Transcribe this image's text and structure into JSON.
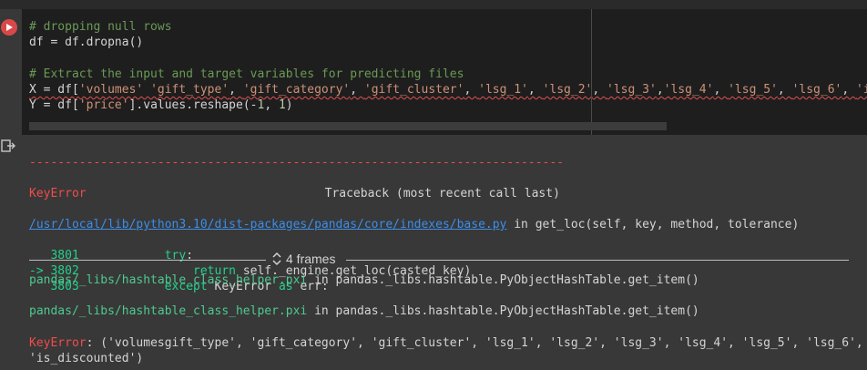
{
  "code_lines": [
    {
      "parts": [
        {
          "c": "cmt",
          "t": "# dropping null rows"
        }
      ]
    },
    {
      "parts": [
        {
          "c": "txt",
          "t": "df = df.dropna()"
        }
      ]
    },
    {
      "parts": [
        {
          "c": "txt",
          "t": ""
        }
      ]
    },
    {
      "parts": [
        {
          "c": "cmt",
          "t": "# Extract the input and target variables for predicting files"
        }
      ]
    },
    {
      "parts": [
        {
          "c": "txt squig",
          "t": "X = df["
        },
        {
          "c": "str squig",
          "t": "'volumes' 'gift_type'"
        },
        {
          "c": "txt squig",
          "t": ", "
        },
        {
          "c": "str squig",
          "t": "'gift_category'"
        },
        {
          "c": "txt squig",
          "t": ", "
        },
        {
          "c": "str squig",
          "t": "'gift_cluster'"
        },
        {
          "c": "txt squig",
          "t": ", "
        },
        {
          "c": "str squig",
          "t": "'lsg_1'"
        },
        {
          "c": "txt squig",
          "t": ", "
        },
        {
          "c": "str squig",
          "t": "'lsg_2'"
        },
        {
          "c": "txt squig",
          "t": ", "
        },
        {
          "c": "str squig",
          "t": "'lsg_3'"
        },
        {
          "c": "txt squig",
          "t": ","
        },
        {
          "c": "str squig",
          "t": "'lsg_4'"
        },
        {
          "c": "txt squig",
          "t": ", "
        },
        {
          "c": "str squig",
          "t": "'lsg_5'"
        },
        {
          "c": "txt squig",
          "t": ", "
        },
        {
          "c": "str squig",
          "t": "'lsg_6'"
        },
        {
          "c": "txt squig",
          "t": ", "
        },
        {
          "c": "str squig",
          "t": "'is"
        }
      ]
    },
    {
      "parts": [
        {
          "c": "txt",
          "t": "Y = df["
        },
        {
          "c": "str",
          "t": "'price'"
        },
        {
          "c": "txt",
          "t": "].values.reshape(-"
        },
        {
          "c": "num",
          "t": "1"
        },
        {
          "c": "txt",
          "t": ", "
        },
        {
          "c": "num",
          "t": "1"
        },
        {
          "c": "txt",
          "t": ")"
        }
      ]
    }
  ],
  "traceback": {
    "dashes": "---------------------------------------------------------------------------",
    "error_name": "KeyError",
    "header": "Traceback (most recent call last)",
    "file_link": "/usr/local/lib/python3.10/dist-packages/pandas/core/indexes/base.py",
    "in_text": " in get_loc(self, key, method, tolerance)",
    "lines": [
      {
        "num": "   3801",
        "code": "            try:"
      },
      {
        "num": "-> 3802",
        "code": "                return self._engine.get_loc(casted_key)"
      },
      {
        "num": "   3803",
        "code": "            except KeyError as err:"
      }
    ],
    "frames_label": "4 frames",
    "frame1_file": "pandas/_libs/hashtable_class_helper.pxi",
    "frame1_in": " in pandas._libs.hashtable.PyObjectHashTable.get_item()",
    "frame2_file": "pandas/_libs/hashtable_class_helper.pxi",
    "frame2_in": " in pandas._libs.hashtable.PyObjectHashTable.get_item()",
    "final_error_name": "KeyError",
    "final_error_msg": ": ('volumesgift_type', 'gift_category', 'gift_cluster', 'lsg_1', 'lsg_2', 'lsg_3', 'lsg_4', 'lsg_5', 'lsg_6',",
    "final_error_msg2": "'is_discounted')"
  },
  "icons": {
    "run": "run-cell-icon",
    "output": "output-icon",
    "frames": "expand-frames-icon"
  },
  "colors": {
    "run_button": "#d94848",
    "error": "#f14c4c",
    "link": "#3b8eea",
    "comment": "#6a9955",
    "string": "#ce9178"
  }
}
